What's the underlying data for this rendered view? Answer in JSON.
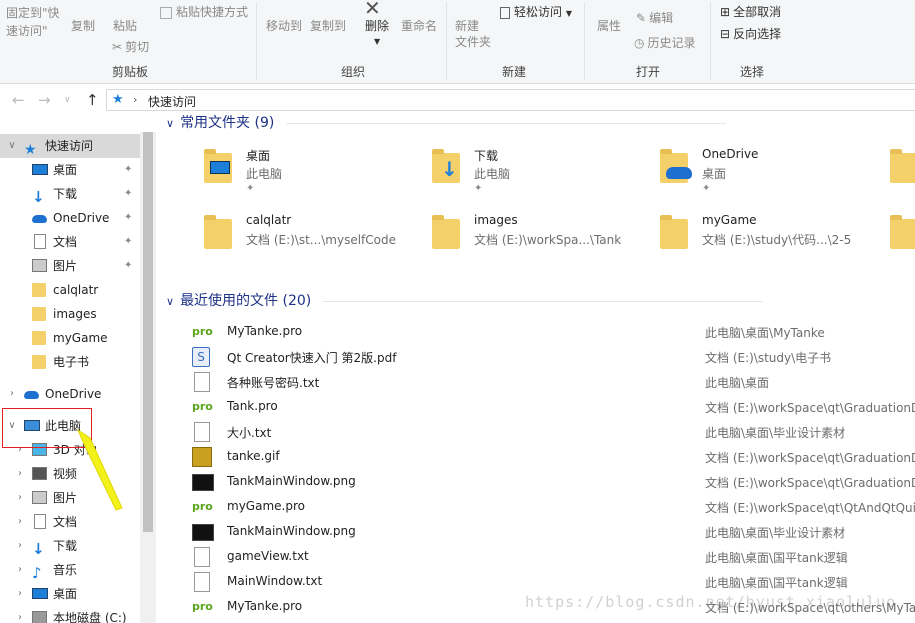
{
  "ribbon": {
    "pin_quick": "固定到\"快速访问\"",
    "copy": "复制",
    "paste": "粘贴",
    "paste_shortcut": "粘贴快捷方式",
    "cut": "剪切",
    "move_to": "移动到",
    "copy_to": "复制到",
    "delete": "删除",
    "rename": "重命名",
    "new_folder": "新建\n文件夹",
    "easy_access": "轻松访问",
    "properties": "属性",
    "edit": "编辑",
    "history": "历史记录",
    "select_none": "全部取消",
    "invert_selection": "反向选择",
    "groups": [
      "剪贴板",
      "组织",
      "新建",
      "打开",
      "选择"
    ]
  },
  "address": {
    "crumb": "快速访问"
  },
  "nav": {
    "items": [
      {
        "label": "快速访问",
        "icon": "star-icon"
      },
      {
        "label": "桌面",
        "icon": "desktop-icon"
      },
      {
        "label": "下载",
        "icon": "download-icon"
      },
      {
        "label": "OneDrive",
        "icon": "onedrive-icon"
      },
      {
        "label": "文档",
        "icon": "document-icon"
      },
      {
        "label": "图片",
        "icon": "picture-icon"
      },
      {
        "label": "calqlatr",
        "icon": "folder-icon"
      },
      {
        "label": "images",
        "icon": "folder-icon"
      },
      {
        "label": "myGame",
        "icon": "folder-icon"
      },
      {
        "label": "电子书",
        "icon": "folder-icon"
      },
      {
        "label": "OneDrive",
        "icon": "onedrive-icon"
      },
      {
        "label": "此电脑",
        "icon": "computer-icon"
      },
      {
        "label": "3D 对象",
        "icon": "3d-objects-icon"
      },
      {
        "label": "视频",
        "icon": "video-icon"
      },
      {
        "label": "图片",
        "icon": "picture-icon"
      },
      {
        "label": "文档",
        "icon": "document-icon"
      },
      {
        "label": "下载",
        "icon": "download-icon"
      },
      {
        "label": "音乐",
        "icon": "music-icon"
      },
      {
        "label": "桌面",
        "icon": "desktop-icon"
      },
      {
        "label": "本地磁盘 (C:)",
        "icon": "drive-icon"
      }
    ]
  },
  "frequent": {
    "header": "常用文件夹 (9)",
    "tiles": [
      {
        "name": "桌面",
        "sub": "此电脑",
        "icon": "desktop-folder-icon"
      },
      {
        "name": "下载",
        "sub": "此电脑",
        "icon": "download-folder-icon"
      },
      {
        "name": "OneDrive",
        "sub": "桌面",
        "icon": "onedrive-folder-icon"
      },
      {
        "name": "calqlatr",
        "sub": "文档 (E:)\\st...\\myselfCode",
        "icon": "folder-icon"
      },
      {
        "name": "images",
        "sub": "文档 (E:)\\workSpa...\\Tank",
        "icon": "folder-icon"
      },
      {
        "name": "myGame",
        "sub": "文档 (E:)\\study\\代码...\\2-5",
        "icon": "folder-icon"
      }
    ]
  },
  "recent": {
    "header": "最近使用的文件 (20)",
    "files": [
      {
        "name": "MyTanke.pro",
        "path": "此电脑\\桌面\\MyTanke",
        "icon": "pro-file-icon"
      },
      {
        "name": "Qt Creator快速入门 第2版.pdf",
        "path": "文档 (E:)\\study\\电子书",
        "icon": "pdf-file-icon"
      },
      {
        "name": "各种账号密码.txt",
        "path": "此电脑\\桌面",
        "icon": "txt-file-icon"
      },
      {
        "name": "Tank.pro",
        "path": "文档 (E:)\\workSpace\\qt\\GraduationD",
        "icon": "pro-file-icon"
      },
      {
        "name": "大小.txt",
        "path": "此电脑\\桌面\\毕业设计素材",
        "icon": "txt-file-icon"
      },
      {
        "name": "tanke.gif",
        "path": "文档 (E:)\\workSpace\\qt\\GraduationD",
        "icon": "gif-file-icon"
      },
      {
        "name": "TankMainWindow.png",
        "path": "文档 (E:)\\workSpace\\qt\\GraduationD",
        "icon": "png-file-icon"
      },
      {
        "name": "myGame.pro",
        "path": "文档 (E:)\\workSpace\\qt\\QtAndQtQui",
        "icon": "pro-file-icon"
      },
      {
        "name": "TankMainWindow.png",
        "path": "此电脑\\桌面\\毕业设计素材",
        "icon": "png-file-icon"
      },
      {
        "name": "gameView.txt",
        "path": "此电脑\\桌面\\国平tank逻辑",
        "icon": "txt-file-icon"
      },
      {
        "name": "MainWindow.txt",
        "path": "此电脑\\桌面\\国平tank逻辑",
        "icon": "txt-file-icon"
      },
      {
        "name": "MyTanke.pro",
        "path": "文档 (E:)\\workSpace\\qt\\others\\MyTa",
        "icon": "pro-file-icon"
      }
    ]
  },
  "watermark": "https://blog.csdn.net/hyust_xiaoluluo"
}
